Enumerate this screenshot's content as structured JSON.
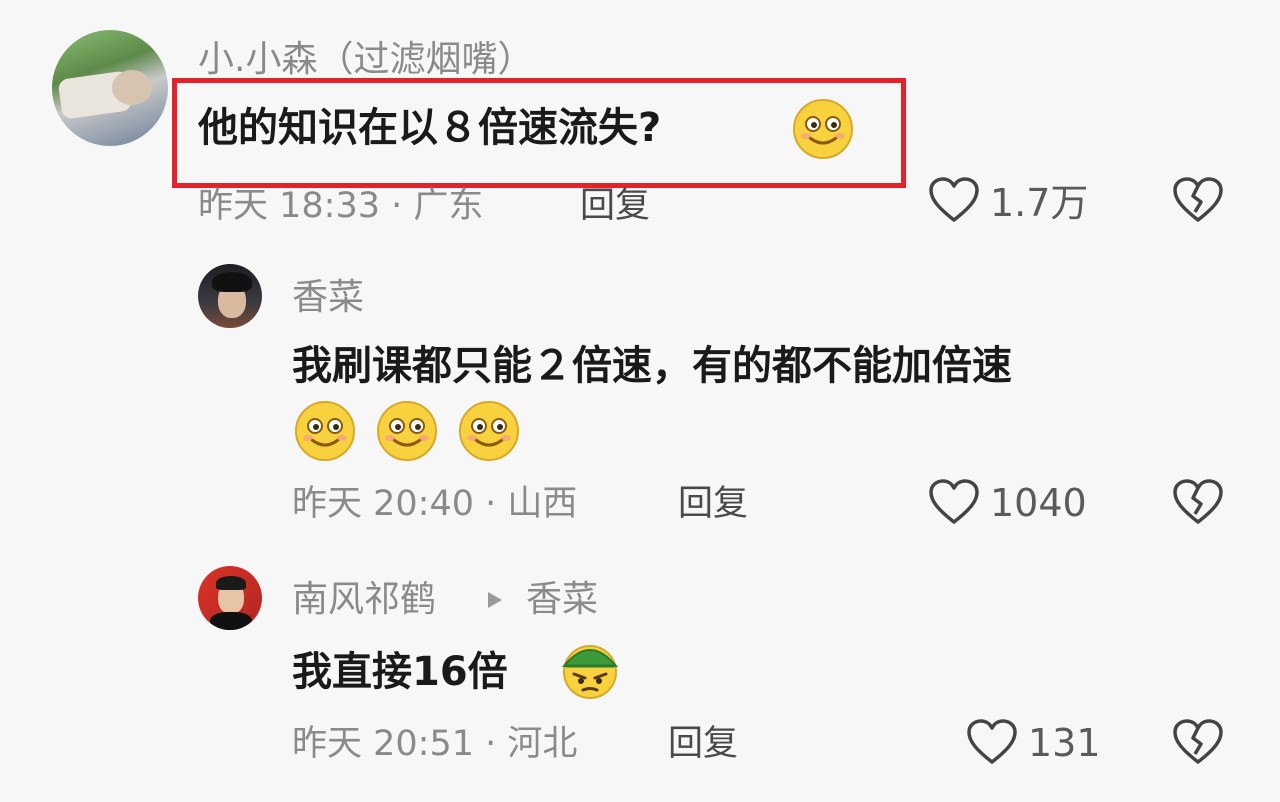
{
  "comments": [
    {
      "author": "小.小森（过滤烟嘴）",
      "text": "他的知识在以８倍速流失?",
      "meta": "昨天 18:33 · 广东",
      "reply": "回复",
      "likes": "1.7万"
    },
    {
      "author": "香菜",
      "text": "我刷课都只能２倍速，有的都不能加倍速",
      "meta": "昨天 20:40 · 山西",
      "reply": "回复",
      "likes": "1040"
    },
    {
      "author": "南风祁鹤",
      "reply_to": "香菜",
      "text": "我直接16倍",
      "meta": "昨天 20:51 · 河北",
      "reply": "回复",
      "likes": "131"
    }
  ],
  "colors": {
    "highlight": "#e3222b",
    "emoji_yellow": "#f7d23e",
    "muted_text": "#8a8a8a"
  }
}
